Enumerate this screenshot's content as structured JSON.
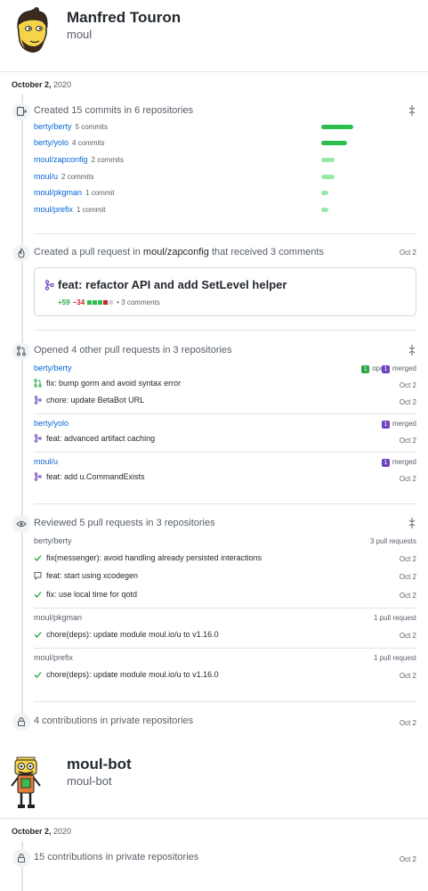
{
  "user1": {
    "name": "Manfred Touron",
    "login": "moul"
  },
  "user2": {
    "name": "moul-bot",
    "login": "moul-bot"
  },
  "period1": {
    "month_day": "October 2,",
    "year": " 2020"
  },
  "period2": {
    "month_day": "October 2,",
    "year": " 2020"
  },
  "commits": {
    "title": "Created 15 commits in 6 repositories",
    "repos": [
      {
        "name": "berty/berty",
        "count": "5 commits",
        "share": 1.0
      },
      {
        "name": "berty/yolo",
        "count": "4 commits",
        "share": 0.8
      },
      {
        "name": "moul/zapconfig",
        "count": "2 commits",
        "share": 0.4
      },
      {
        "name": "moul/u",
        "count": "2 commits",
        "share": 0.4
      },
      {
        "name": "moul/pkgman",
        "count": "1 commit",
        "share": 0.2
      },
      {
        "name": "moul/prefix",
        "count": "1 commit",
        "share": 0.2
      }
    ]
  },
  "pull_request": {
    "prefix": "Created a pull request in ",
    "repo": "moul/zapconfig",
    "suffix": " that received 3 comments",
    "date": "Oct 2",
    "title": "feat: refactor API and add SetLevel helper",
    "additions": "+59",
    "deletions": "−34",
    "comments": "• 3 comments"
  },
  "opened": {
    "title": "Opened 4 other pull requests in 3 repositories",
    "groups": [
      {
        "repo": "berty/berty",
        "open_count": "1",
        "open_label": "open",
        "merged_count": "1",
        "merged_label": "merged",
        "items": [
          {
            "title": "fix: bump gorm and avoid syntax error",
            "date": "Oct 2",
            "state": "open"
          },
          {
            "title": "chore: update BetaBot URL",
            "date": "Oct 2",
            "state": "merged"
          }
        ]
      },
      {
        "repo": "berty/yolo",
        "merged_count": "1",
        "merged_label": "merged",
        "items": [
          {
            "title": "feat: advanced artifact caching",
            "date": "Oct 2",
            "state": "merged"
          }
        ]
      },
      {
        "repo": "moul/u",
        "merged_count": "1",
        "merged_label": "merged",
        "items": [
          {
            "title": "feat: add u.CommandExists",
            "date": "Oct 2",
            "state": "merged"
          }
        ]
      }
    ]
  },
  "reviewed": {
    "title": "Reviewed 5 pull requests in 3 repositories",
    "groups": [
      {
        "repo": "berty/berty",
        "count": "3 pull requests",
        "items": [
          {
            "title": "fix(messenger): avoid handling already persisted interactions",
            "date": "Oct 2",
            "icon": "check"
          },
          {
            "title": "feat: start using xcodegen",
            "date": "Oct 2",
            "icon": "comment"
          },
          {
            "title": "fix: use local time for qotd",
            "date": "Oct 2",
            "icon": "check"
          }
        ]
      },
      {
        "repo": "moul/pkgman",
        "count": "1 pull request",
        "items": [
          {
            "title": "chore(deps): update module moul.io/u to v1.16.0",
            "date": "Oct 2",
            "icon": "check"
          }
        ]
      },
      {
        "repo": "moul/prefix",
        "count": "1 pull request",
        "items": [
          {
            "title": "chore(deps): update module moul.io/u to v1.16.0",
            "date": "Oct 2",
            "icon": "check"
          }
        ]
      }
    ]
  },
  "private1": {
    "title": "4 contributions in private repositories",
    "date": "Oct 2"
  },
  "private2": {
    "title": "15 contributions in private repositories",
    "date": "Oct 2"
  },
  "colors": {
    "link": "#0366d6",
    "open": "#28a745",
    "merged": "#6f42c1",
    "bar_dark": "#2cbe4e",
    "bar_light": "#9be9a8"
  }
}
